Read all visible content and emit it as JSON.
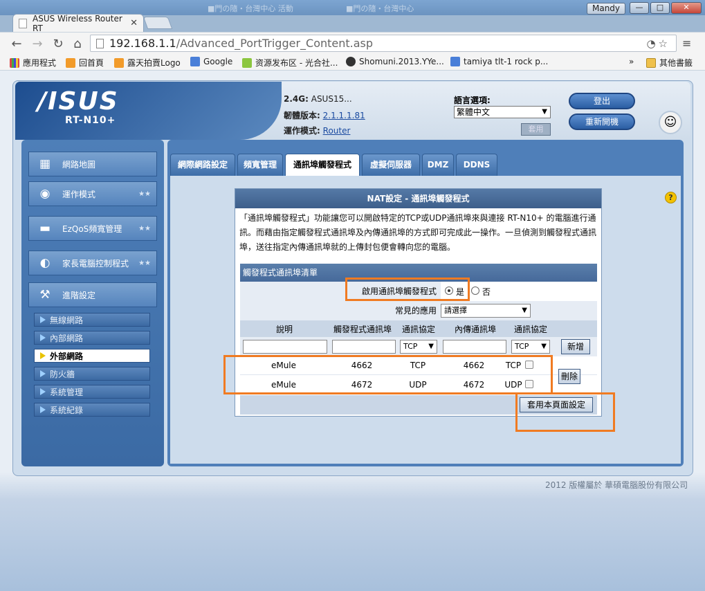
{
  "browser": {
    "tab_title": "ASUS Wireless Router RT",
    "user": "Mandy",
    "ghost_tabs": [
      "■門の隨・台灣中心 活動",
      "■門の隨・台灣中心"
    ],
    "url_host": "192.168.1.1",
    "url_path": "/Advanced_PortTrigger_Content.asp",
    "bookmarks": [
      "應用程式",
      "回首頁",
      "露天拍賣Logo",
      "Google",
      "资源发布区 - 光合社...",
      "Shomuni.2013.YYe...",
      "tamiya tlt-1 rock p...",
      "»",
      "其他書籤"
    ],
    "nav_icons": [
      "back-arrow-icon",
      "forward-arrow-icon",
      "reload-icon",
      "home-icon"
    ]
  },
  "header": {
    "brand": "/ISUS",
    "model": "RT-N10+",
    "ssid_label": "2.4G:",
    "ssid_value": "ASUS15...",
    "firmware_label": "韌體版本:",
    "firmware_value": "2.1.1.1.81",
    "mode_label": "運作模式:",
    "mode_value": "Router",
    "lang_label": "語言選項:",
    "lang_value": "繁體中文",
    "lang_apply": "套用",
    "logout": "登出",
    "reboot": "重新開機"
  },
  "sidebar": {
    "menu": [
      {
        "label": "網路地圖",
        "icon": "network-map-icon"
      },
      {
        "label": "運作模式",
        "icon": "router-icon"
      },
      {
        "label": "EzQoS頻寬管理",
        "icon": "qos-icon"
      },
      {
        "label": "家長電腦控制程式",
        "icon": "parental-control-icon"
      },
      {
        "label": "進階設定",
        "icon": "tools-icon"
      }
    ],
    "sub": [
      "無線網路",
      "內部網路",
      "外部網路",
      "防火牆",
      "系統管理",
      "系統紀錄"
    ]
  },
  "tabs": [
    "網際網路設定",
    "頻寬管理",
    "通訊埠觸發程式",
    "虛擬伺服器",
    "DMZ",
    "DDNS"
  ],
  "panel": {
    "title": "NAT設定 - 通訊埠觸發程式",
    "description": "「通訊埠觸發程式」功能讓您可以開啟特定的TCP或UDP通訊埠來與連接 RT-N10+ 的電腦進行通訊。而藉由指定觸發程式通訊埠及內傳通訊埠的方式即可完成此一操作。一旦偵測到觸發程式通訊埠，送往指定內傳通訊埠就的上傳封包便會轉向您的電腦。",
    "section_title": "觸發程式通訊埠清單",
    "enable_label": "啟用通訊埠觸發程式",
    "enable_yes": "是",
    "enable_no": "否",
    "common_label": "常見的應用",
    "common_value": "請選擇",
    "columns": [
      "說明",
      "觸發程式通訊埠",
      "通訊協定",
      "內傳通訊埠",
      "通訊協定"
    ],
    "new_proto1": "TCP",
    "new_proto2": "TCP",
    "add_button": "新增",
    "delete_button": "刪除",
    "apply_button": "套用本頁面設定",
    "rows": [
      {
        "desc": "eMule",
        "trigger_port": "4662",
        "proto": "TCP",
        "incoming_port": "4662",
        "in_proto": "TCP"
      },
      {
        "desc": "eMule",
        "trigger_port": "4672",
        "proto": "UDP",
        "incoming_port": "4672",
        "in_proto": "UDP"
      }
    ]
  },
  "footer": {
    "copyright": "2012 版權屬於 華碩電腦股份有限公司"
  },
  "colors": {
    "highlight": "#f07b22",
    "accent": "#3d5f8b"
  }
}
